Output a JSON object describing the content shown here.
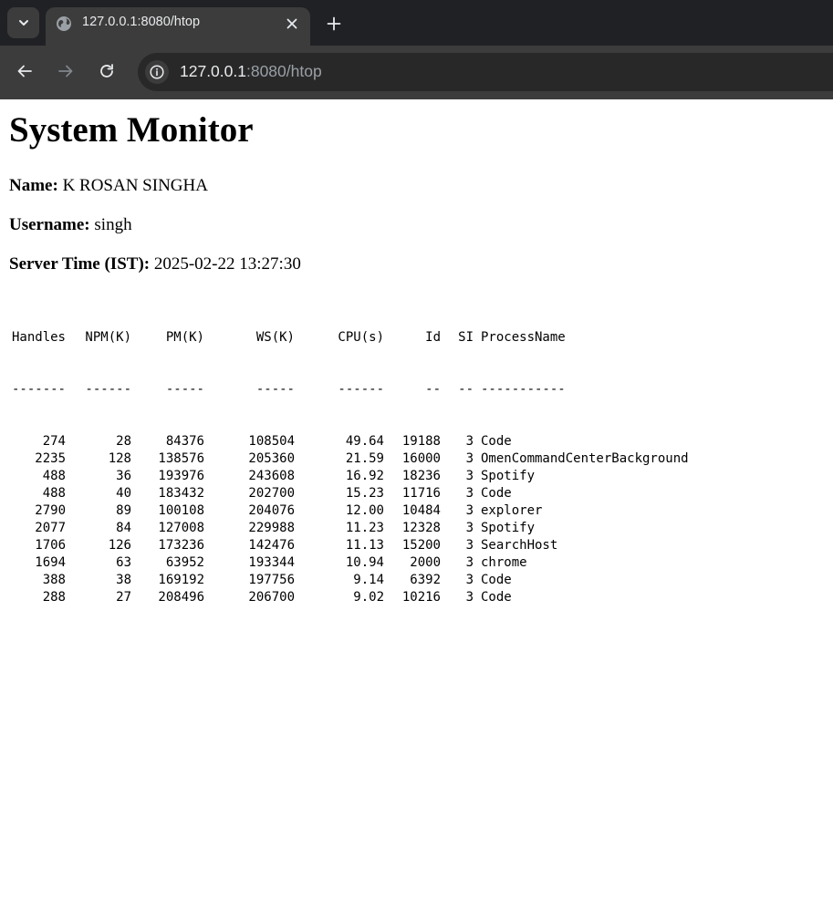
{
  "browser": {
    "tab_title": "127.0.0.1:8080/htop",
    "url_host": "127.0.0.1",
    "url_path": ":8080/htop"
  },
  "page": {
    "title": "System Monitor",
    "name_label": "Name:",
    "name_value": "K ROSAN SINGHA",
    "username_label": "Username:",
    "username_value": "singh",
    "server_time_label": "Server Time (IST):",
    "server_time_value": "2025-02-22 13:27:30"
  },
  "table": {
    "headers": [
      "Handles",
      "NPM(K)",
      "PM(K)",
      "WS(K)",
      "CPU(s)",
      "Id",
      "SI",
      "ProcessName"
    ],
    "separators": [
      "-------",
      "------",
      "-----",
      "-----",
      "------",
      "--",
      "--",
      "-----------"
    ],
    "rows": [
      [
        "274",
        "28",
        "84376",
        "108504",
        "49.64",
        "19188",
        "3",
        "Code"
      ],
      [
        "2235",
        "128",
        "138576",
        "205360",
        "21.59",
        "16000",
        "3",
        "OmenCommandCenterBackground"
      ],
      [
        "488",
        "36",
        "193976",
        "243608",
        "16.92",
        "18236",
        "3",
        "Spotify"
      ],
      [
        "488",
        "40",
        "183432",
        "202700",
        "15.23",
        "11716",
        "3",
        "Code"
      ],
      [
        "2790",
        "89",
        "100108",
        "204076",
        "12.00",
        "10484",
        "3",
        "explorer"
      ],
      [
        "2077",
        "84",
        "127008",
        "229988",
        "11.23",
        "12328",
        "3",
        "Spotify"
      ],
      [
        "1706",
        "126",
        "173236",
        "142476",
        "11.13",
        "15200",
        "3",
        "SearchHost"
      ],
      [
        "1694",
        "63",
        "63952",
        "193344",
        "10.94",
        "2000",
        "3",
        "chrome"
      ],
      [
        "388",
        "38",
        "169192",
        "197756",
        "9.14",
        "6392",
        "3",
        "Code"
      ],
      [
        "288",
        "27",
        "208496",
        "206700",
        "9.02",
        "10216",
        "3",
        "Code"
      ]
    ]
  }
}
